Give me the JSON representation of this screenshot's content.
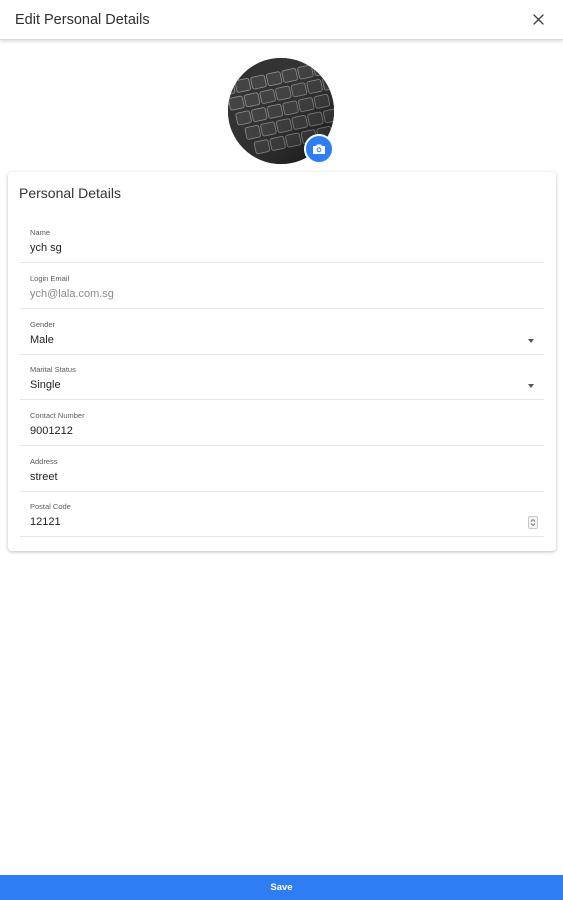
{
  "header": {
    "title": "Edit Personal Details",
    "close_icon": "close-icon"
  },
  "avatar": {
    "alt_icon": "keyboard-photo",
    "camera_icon": "camera-icon"
  },
  "card": {
    "title": "Personal Details",
    "fields": [
      {
        "label": "Name",
        "value": "ych sg"
      },
      {
        "label": "Login Email",
        "value": "ych@lala.com.sg"
      },
      {
        "label": "Gender",
        "value": "Male"
      },
      {
        "label": "Marital Status",
        "value": "Single"
      },
      {
        "label": "Contact Number",
        "value": "9001212"
      },
      {
        "label": "Address",
        "value": "street"
      },
      {
        "label": "Postal Code",
        "value": "12121"
      }
    ]
  },
  "footer": {
    "save_label": "Save"
  },
  "colors": {
    "accent": "#2f7df3"
  }
}
